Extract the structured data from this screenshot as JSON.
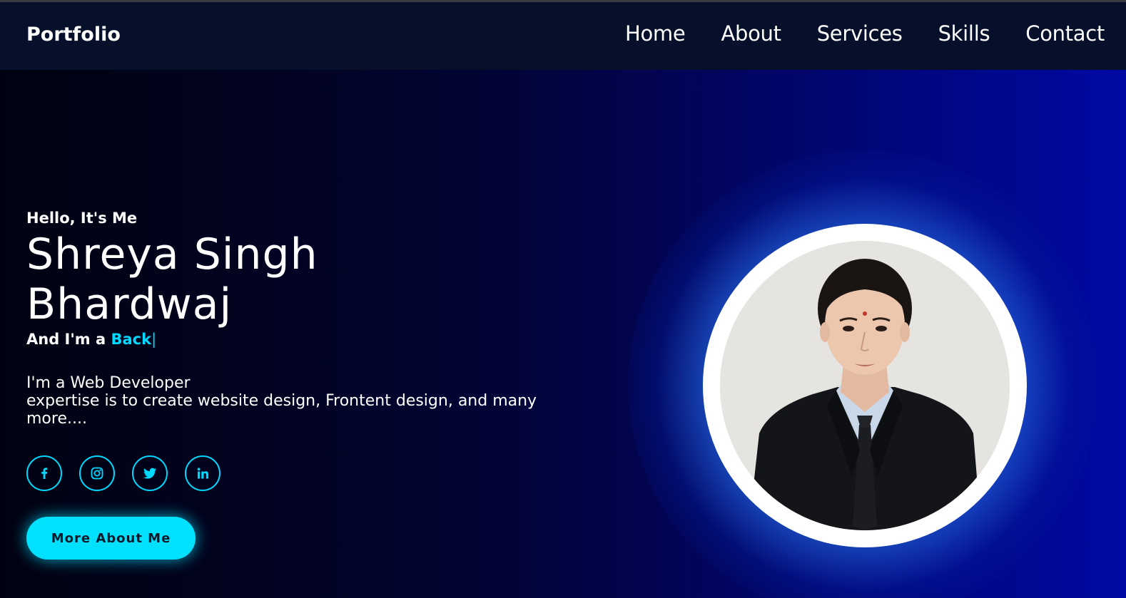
{
  "brand": "Portfolio",
  "nav": {
    "items": [
      "Home",
      "About",
      "Services",
      "Skills",
      "Contact"
    ]
  },
  "hero": {
    "greeting": "Hello, It's Me",
    "name_line1": "Shreya Singh",
    "name_line2": "Bhardwaj",
    "role_prefix": "And I'm a",
    "role_typed": "Back",
    "cursor": "|",
    "description_line1": "I'm a Web Developer",
    "description_line2": "expertise is to create website design, Frontent design, and many more....",
    "button_label": "More About Me"
  },
  "socials": [
    "facebook-icon",
    "instagram-icon",
    "twitter-icon",
    "linkedin-icon"
  ],
  "colors": {
    "accent": "#00d9ff",
    "header_bg": "#06102a",
    "button_bg": "#00e0ff"
  }
}
